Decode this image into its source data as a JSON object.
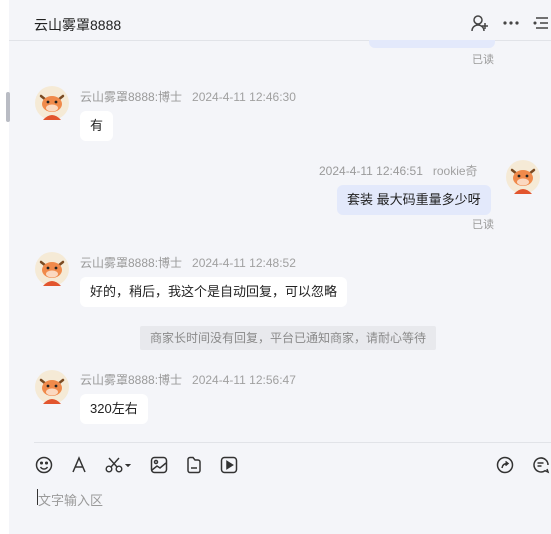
{
  "header": {
    "title": "云山雾罩8888",
    "icons": [
      "add-user-icon",
      "more-icon",
      "menu-icon"
    ]
  },
  "messages": [
    {
      "type": "read",
      "status": "已读"
    },
    {
      "type": "incoming",
      "sender": "云山雾罩8888:博士",
      "time": "2024-4-11 12:46:30",
      "text": "有"
    },
    {
      "type": "outgoing",
      "sender": "rookie奇",
      "time": "2024-4-11 12:46:51",
      "text": "套装 最大码重量多少呀",
      "status": "已读"
    },
    {
      "type": "incoming",
      "sender": "云山雾罩8888:博士",
      "time": "2024-4-11 12:48:52",
      "text": "好的，稍后，我这个是自动回复，可以忽略"
    },
    {
      "type": "system",
      "text": "商家长时间没有回复，平台已通知商家，请耐心等待"
    },
    {
      "type": "incoming",
      "sender": "云山雾罩8888:博士",
      "time": "2024-4-11 12:56:47",
      "text": "320左右"
    }
  ],
  "toolbar": {
    "icons": [
      "emoji-icon",
      "font-icon",
      "scissors-icon",
      "image-icon",
      "file-icon",
      "video-icon",
      "share-icon",
      "quick-reply-icon"
    ]
  },
  "input": {
    "placeholder": "文字输入区",
    "value": ""
  },
  "colors": {
    "background": "#f4f5f9",
    "bubble_incoming": "#ffffff",
    "bubble_outgoing": "#e3e9fb",
    "meta_text": "#9a9a9a"
  }
}
